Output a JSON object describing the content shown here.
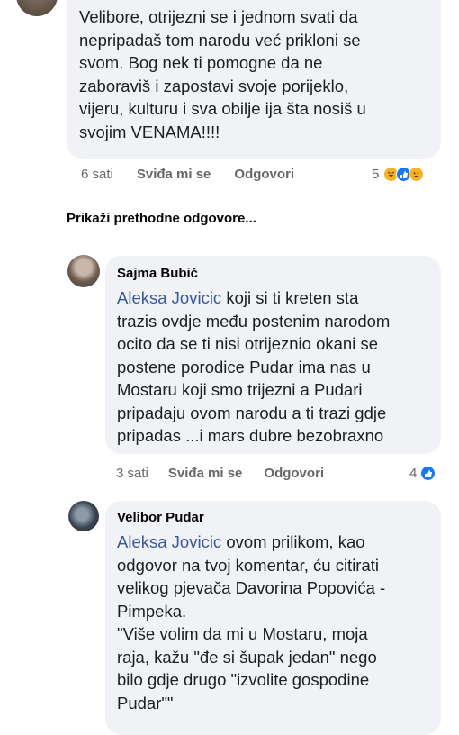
{
  "comment1": {
    "lines": [
      "Velibore, otrijezni se i jednom svati da",
      "nepripadaš tom narodu već prikloni se",
      "svom. Bog nek ti pomogne da ne",
      "zaboraviš i zapostavi svoje porijeklo,",
      "vijeru, kulturu i sva obilje ija šta nosiš u",
      "svojim VENAMA!!!!"
    ],
    "time": "6 sati",
    "like": "Sviđa mi se",
    "reply": "Odgovori",
    "reaction_count": "5"
  },
  "show_previous": "Prikaži prethodne odgovore...",
  "comment2": {
    "author": "Sajma Bubić",
    "mention": "Aleksa Jovicic",
    "lines": [
      " koji si ti kreten sta",
      "trazis ovdje među postenim narodom",
      "ocito da se ti nisi otrijeznio okani se",
      "postene porodice Pudar ima nas u",
      "Mostaru koji smo trijezni a Pudari",
      "pripadaju ovom narodu a ti trazi gdje",
      "pripadas ...i mars đubre bezobraxno"
    ],
    "time": "3 sati",
    "like": "Sviđa mi se",
    "reply": "Odgovori",
    "reaction_count": "4"
  },
  "comment3": {
    "author": "Velibor Pudar",
    "mention": "Aleksa Jovicic",
    "lines": [
      " ovom prilikom, kao",
      "odgovor na tvoj komentar, ću citirati",
      "velikog pjevača Davorina Popovića -",
      "Pimpeka.",
      "\"Više volim da mi u Mostaru, moja",
      "raja, kažu \"đe si šupak jedan\" nego",
      "bilo gdje drugo \"izvolite gospodine",
      "Pudar\"\""
    ]
  },
  "colors": {
    "link": "#385898",
    "like_blue": "#1877f2",
    "bubble": "#f0f2f5"
  }
}
